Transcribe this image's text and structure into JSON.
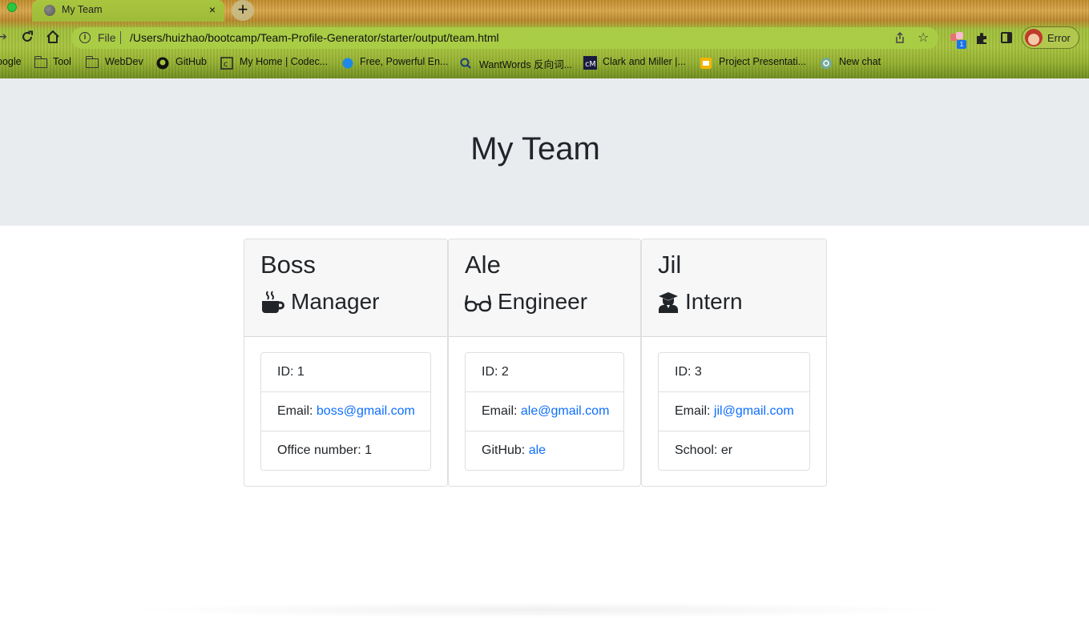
{
  "browser": {
    "tab_title": "My Team",
    "tab_close": "×",
    "new_tab": "+",
    "scheme_label": "File",
    "url": "/Users/huizhao/bootcamp/Team-Profile-Generator/starter/output/team.html",
    "extension_badge": "1",
    "profile_label": "Error",
    "bookmarks": [
      {
        "label": "oogle",
        "icon": "none"
      },
      {
        "label": "Tool",
        "icon": "folder-icon"
      },
      {
        "label": "WebDev",
        "icon": "folder-icon"
      },
      {
        "label": "GitHub",
        "icon": "github-icon"
      },
      {
        "label": "My Home | Codec...",
        "icon": "codecademy-icon"
      },
      {
        "label": "Free, Powerful En...",
        "icon": "globe-icon"
      },
      {
        "label": "WantWords 反向词...",
        "icon": "search-icon"
      },
      {
        "label": "Clark and Miller |...",
        "icon": "cm-icon"
      },
      {
        "label": "Project Presentati...",
        "icon": "slides-icon"
      },
      {
        "label": "New chat",
        "icon": "chatgpt-icon"
      }
    ]
  },
  "page": {
    "title": "My Team",
    "link_color": "#0d6efd",
    "header_bg": "#e9ecef"
  },
  "team": [
    {
      "name": "Boss",
      "role": "Manager",
      "role_icon": "coffee-mug-icon",
      "id_label": "ID: 1",
      "email_prefix": "Email: ",
      "email": "boss@gmail.com",
      "extra_prefix": "Office number: 1",
      "extra_link": ""
    },
    {
      "name": "Ale",
      "role": "Engineer",
      "role_icon": "glasses-icon",
      "id_label": "ID: 2",
      "email_prefix": "Email: ",
      "email": "ale@gmail.com",
      "extra_prefix": "GitHub: ",
      "extra_link": "ale"
    },
    {
      "name": "Jil",
      "role": "Intern",
      "role_icon": "graduate-icon",
      "id_label": "ID: 3",
      "email_prefix": "Email: ",
      "email": "jil@gmail.com",
      "extra_prefix": "School: er",
      "extra_link": ""
    }
  ]
}
